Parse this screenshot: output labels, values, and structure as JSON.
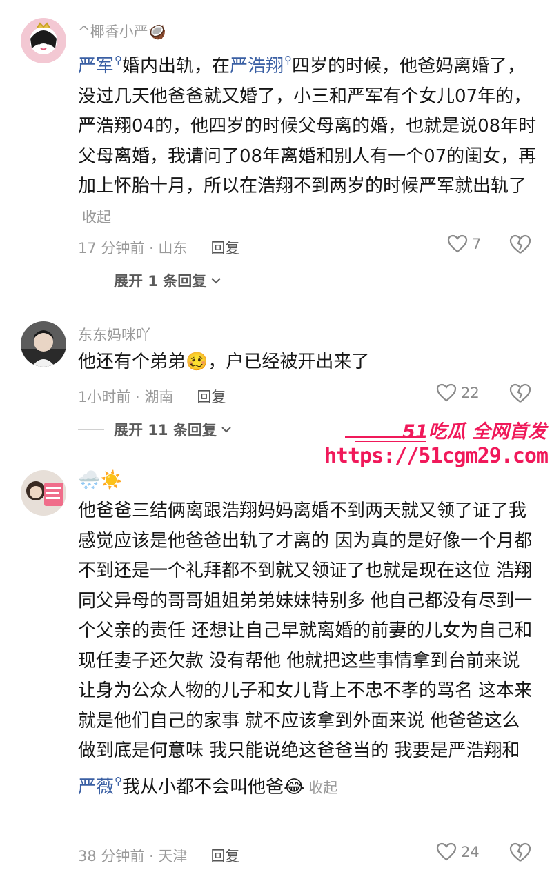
{
  "comments": [
    {
      "username": "^椰香小严",
      "username_emoji": "🥥",
      "segments": [
        {
          "t": "严军",
          "mention": true
        },
        {
          "t": "婚内出轨，在"
        },
        {
          "t": "严浩翔",
          "mention": true
        },
        {
          "t": "四岁的时候，他爸妈离婚了，没过几天他爸爸就又婚了，小三和严军有个女儿07年的，严浩翔04的，他四岁的时候父母离的婚，也就是说08年时父母离婚，我请问了08年离婚和别人有一个07的闺女，再加上怀胎十月，所以在浩翔不到两岁的时候严军就出轨了"
        }
      ],
      "fold_label": "收起",
      "time_location": "17 分钟前 · 山东",
      "reply_label": "回复",
      "likes": "7",
      "expand_label": "展开 1 条回复"
    },
    {
      "username": "东东妈咪吖",
      "segments": [
        {
          "t": "他还有个弟弟"
        },
        {
          "t": "🥴",
          "emoji": true
        },
        {
          "t": "，户已经被开出来了"
        }
      ],
      "time_location": "1小时前 · 湖南",
      "reply_label": "回复",
      "likes": "22",
      "expand_label": "展开 11 条回复"
    },
    {
      "username": "🌨️☀️",
      "segments": [
        {
          "t": "他爸爸三结俩离跟浩翔妈妈离婚不到两天就又领了证了我感觉应该是他爸爸出轨了才离的 因为真的是好像一个月都不到还是一个礼拜都不到就又领证了也就是现在这位 浩翔同父异母的哥哥姐姐弟弟妹妹特别多 他自己都没有尽到一个父亲的责任 还想让自己早就离婚的前妻的儿女为自己和现任妻子还欠款 没有帮他 他就把这些事情拿到台前来说让身为公众人物的儿子和女儿背上不忠不孝的骂名 这本来就是他们自己的家事 就不应该拿到外面来说 他爸爸这么做到底是何意味 我只能说绝这爸爸当的 我要是严浩翔和"
        },
        {
          "t": "严薇",
          "mention": true
        },
        {
          "t": "我从小都不会叫他爸"
        },
        {
          "t": "😂",
          "emoji": true
        }
      ],
      "fold_label": "收起",
      "time_location": "38 分钟前 · 天津",
      "reply_label": "回复",
      "likes": "24"
    }
  ],
  "watermark": {
    "brand": "51吃瓜 全网首发",
    "url": "https://51cgm29.com"
  },
  "colors": {
    "mention": "#3a5fa3",
    "watermark": "#f0195a",
    "meta": "#9a9a9a"
  },
  "icons": {
    "like": "heart-outline-icon",
    "dislike": "broken-heart-icon",
    "expand": "chevron-down-icon",
    "mention": "search-icon"
  }
}
